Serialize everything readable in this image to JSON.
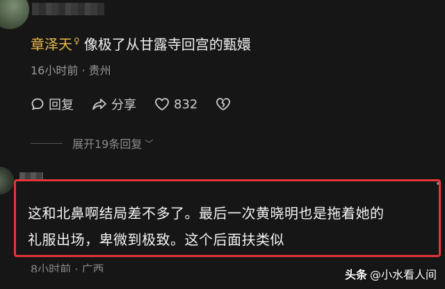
{
  "comment": {
    "username": "章泽天",
    "content": "像极了从甘露寺回宫的甄嬛",
    "time": "16小时前",
    "location": "贵州",
    "separator": "·",
    "actions": {
      "reply_label": "回复",
      "share_label": "分享",
      "like_count": "832"
    },
    "expand_label": "展开19条回复"
  },
  "highlighted_reply": {
    "line1": "这和北鼻啊结局差不多了。最后一次黄晓明也是拖着她的",
    "line2": "礼服出场，卑微到极致。这个后面扶类似",
    "meta": "8小时前 · 广西"
  },
  "watermark": {
    "brand": "头条",
    "account": "@小水看人间"
  },
  "colors": {
    "username": "#e9b94a",
    "highlight_border": "#e8343a",
    "background": "#161616"
  }
}
